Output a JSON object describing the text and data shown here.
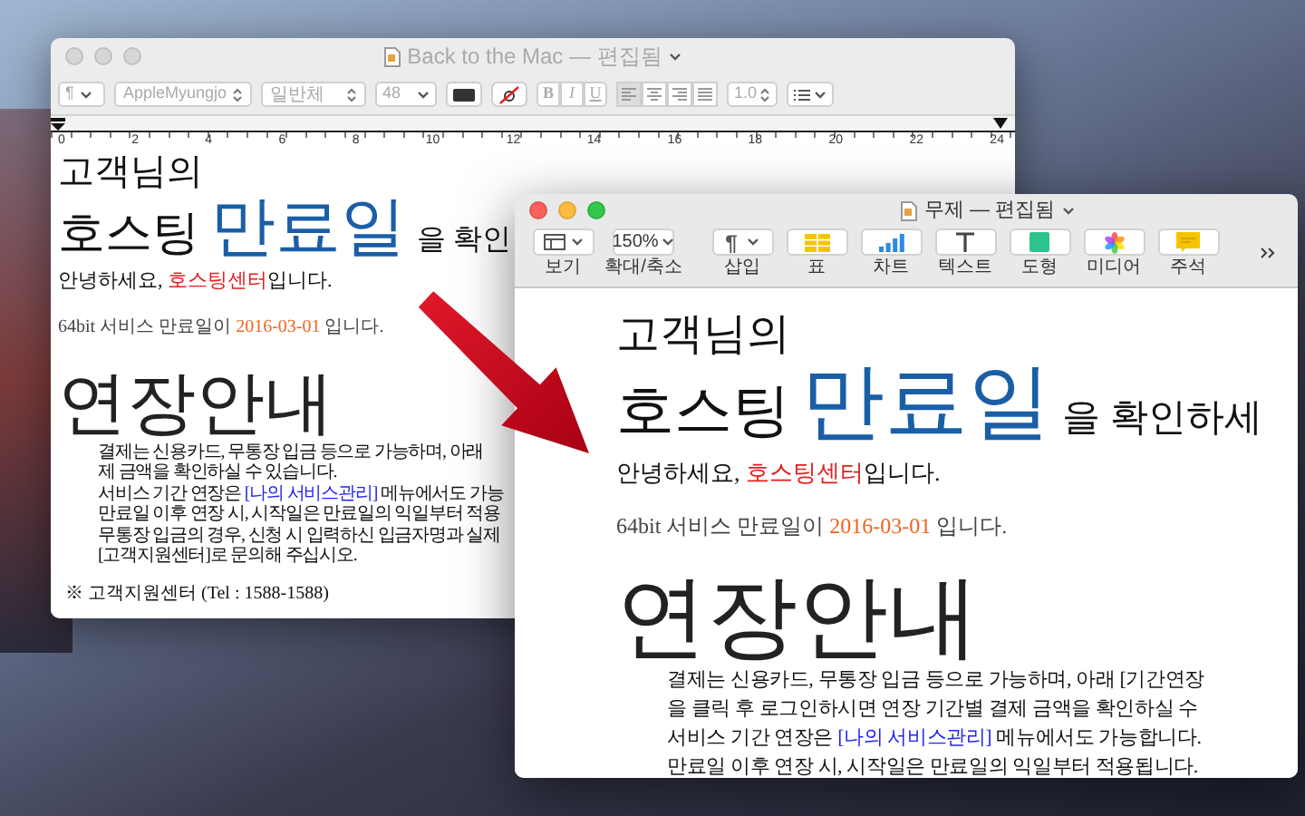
{
  "back_window": {
    "active": false,
    "title": "Back to the Mac — 편집됨",
    "toolbar": {
      "paragraph_menu": "¶",
      "font_family": "AppleMyungjo",
      "typeface": "일반체",
      "font_size": "48",
      "bold": "B",
      "italic": "I",
      "underline": "U",
      "line_spacing": "1.0"
    },
    "ruler": {
      "labels": [
        "0",
        "2",
        "4",
        "6",
        "8",
        "10",
        "12",
        "14",
        "16",
        "18",
        "20",
        "22",
        "24"
      ]
    },
    "document": {
      "greeting_title": "고객님의",
      "headline": {
        "lead": "호스팅",
        "highlight": "만료일",
        "tail": "을 확인"
      },
      "intro": {
        "before": "안녕하세요, ",
        "highlight": "호스팅센터",
        "after": "입니다."
      },
      "notice": {
        "before": "64bit 서비스 만료일이 ",
        "date": "2016-03-01",
        "after": " 입니다."
      },
      "section_title": "연장안내",
      "paragraph": [
        {
          "segments": [
            {
              "text": "결제는 신용카드, 무통장 입금 등으로 가능하며, 아래",
              "link": false
            }
          ]
        },
        {
          "segments": [
            {
              "text": "제 금액을 확인하실 수 있습니다.",
              "link": false
            }
          ]
        },
        {
          "segments": [
            {
              "text": "서비스 기간 연장은 ",
              "link": false
            },
            {
              "text": "[나의 서비스관리]",
              "link": true
            },
            {
              "text": " 메뉴에서도 가능",
              "link": false
            }
          ]
        },
        {
          "segments": [
            {
              "text": "만료일 이후 연장 시, 시작일은 만료일의 익일부터 적용",
              "link": false
            }
          ]
        },
        {
          "segments": [
            {
              "text": "무통장 입금의 경우, 신청 시 입력하신 입금자명과 실제",
              "link": false
            }
          ]
        },
        {
          "segments": [
            {
              "text": "[고객지원센터]로 문의해 주십시오.",
              "link": false
            }
          ]
        }
      ],
      "footer": "※ 고객지원센터 (Tel : 1588-1588)"
    }
  },
  "front_window": {
    "active": true,
    "title": "무제 — 편집됨",
    "toolbar": [
      {
        "kind": "view",
        "label": "보기"
      },
      {
        "kind": "zoom",
        "label": "확대/축소",
        "value": "150%"
      },
      {
        "kind": "insert",
        "label": "삽입",
        "symbol": "¶"
      },
      {
        "kind": "table",
        "label": "표"
      },
      {
        "kind": "chart",
        "label": "차트"
      },
      {
        "kind": "text",
        "label": "텍스트"
      },
      {
        "kind": "shape",
        "label": "도형"
      },
      {
        "kind": "media",
        "label": "미디어"
      },
      {
        "kind": "comment",
        "label": "주석"
      }
    ],
    "document": {
      "greeting_title": "고객님의",
      "headline": {
        "lead": "호스팅",
        "highlight": "만료일",
        "tail": "을 확인하세"
      },
      "intro": {
        "before": "안녕하세요, ",
        "highlight": "호스팅센터",
        "after": "입니다."
      },
      "notice": {
        "before": "64bit 서비스 만료일이 ",
        "date": "2016-03-01",
        "after": " 입니다."
      },
      "section_title": "연장안내",
      "paragraph": [
        {
          "segments": [
            {
              "text": "결제는 신용카드, 무통장 입금 등으로 가능하며, 아래 [기간연장",
              "link": false
            }
          ]
        },
        {
          "segments": [
            {
              "text": "을 클릭 후 로그인하시면 연장 기간별 결제 금액을 확인하실 수",
              "link": false
            }
          ]
        },
        {
          "segments": [
            {
              "text": "서비스 기간 연장은 ",
              "link": false
            },
            {
              "text": "[나의 서비스관리]",
              "link": true
            },
            {
              "text": " 메뉴에서도 가능합니다.",
              "link": false
            }
          ]
        },
        {
          "segments": [
            {
              "text": "만료일 이후 연장 시, 시작일은 만료일의 익일부터 적용됩니다.",
              "link": false
            }
          ]
        }
      ]
    }
  }
}
